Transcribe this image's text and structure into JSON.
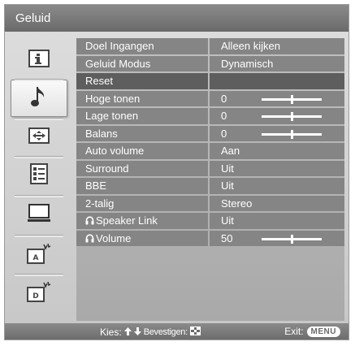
{
  "title": "Geluid",
  "sidebar": [
    {
      "icon": "picture-settings-icon",
      "active": false
    },
    {
      "icon": "music-note-icon",
      "active": true
    },
    {
      "icon": "screen-adjust-icon",
      "active": false
    },
    {
      "icon": "settings-list-icon",
      "active": false
    },
    {
      "icon": "monitor-icon",
      "active": false
    },
    {
      "icon": "analog-setup-icon",
      "active": false
    },
    {
      "icon": "digital-setup-icon",
      "active": false
    }
  ],
  "rows": [
    {
      "label": "Doel Ingangen",
      "value": "Alleen kijken",
      "selected": false
    },
    {
      "label": "Geluid Modus",
      "value": "Dynamisch",
      "selected": false
    },
    {
      "label": "Reset",
      "value": "",
      "selected": true
    },
    {
      "label": "Hoge tonen",
      "value": "0",
      "slider_fraction": 0.5,
      "selected": false
    },
    {
      "label": "Lage tonen",
      "value": "0",
      "slider_fraction": 0.5,
      "selected": false
    },
    {
      "label": "Balans",
      "value": "0",
      "slider_fraction": 0.5,
      "selected": false
    },
    {
      "label": "Auto volume",
      "value": "Aan",
      "selected": false
    },
    {
      "label": "Surround",
      "value": "Uit",
      "selected": false
    },
    {
      "label": "BBE",
      "value": "Uit",
      "selected": false
    },
    {
      "label": "2-talig",
      "value": "Stereo",
      "selected": false
    },
    {
      "label": "Speaker Link",
      "value": "Uit",
      "headphone": true,
      "selected": false
    },
    {
      "label": "Volume",
      "value": "50",
      "headphone": true,
      "slider_fraction": 0.5,
      "selected": false
    }
  ],
  "footer": {
    "kies": "Kies:",
    "bevestigen": "Bevestigen:",
    "exit": "Exit:",
    "menu_button": "MENU"
  }
}
